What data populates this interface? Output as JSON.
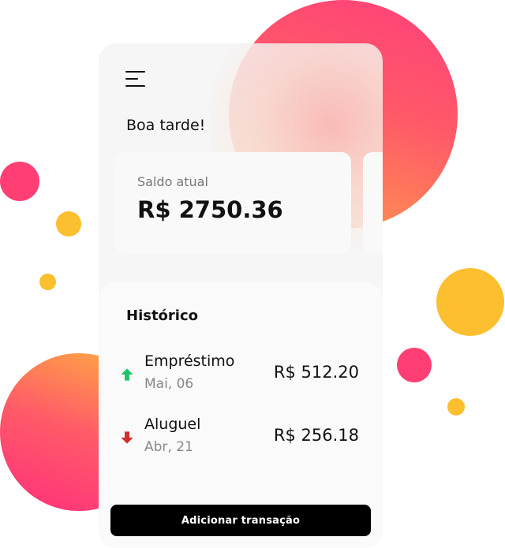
{
  "header": {
    "menu_icon": "hamburger-menu-icon",
    "greeting": "Boa tarde!"
  },
  "balance": {
    "label": "Saldo atual",
    "value": "R$ 2750.36"
  },
  "history": {
    "title": "Histórico",
    "transactions": [
      {
        "name": "Empréstimo",
        "date": "Mai, 06",
        "amount": "R$ 512.20",
        "direction": "up",
        "icon": "arrow-up-icon",
        "color": "#1fc46a"
      },
      {
        "name": "Aluguel",
        "date": "Abr, 21",
        "amount": "R$ 256.18",
        "direction": "down",
        "icon": "arrow-down-icon",
        "color": "#d42c2c"
      }
    ]
  },
  "actions": {
    "add_transaction_label": "Adicionar  transação"
  },
  "colors": {
    "accent_pink": "#ff3f73",
    "accent_yellow": "#fbbf2f",
    "button_bg": "#000000"
  }
}
